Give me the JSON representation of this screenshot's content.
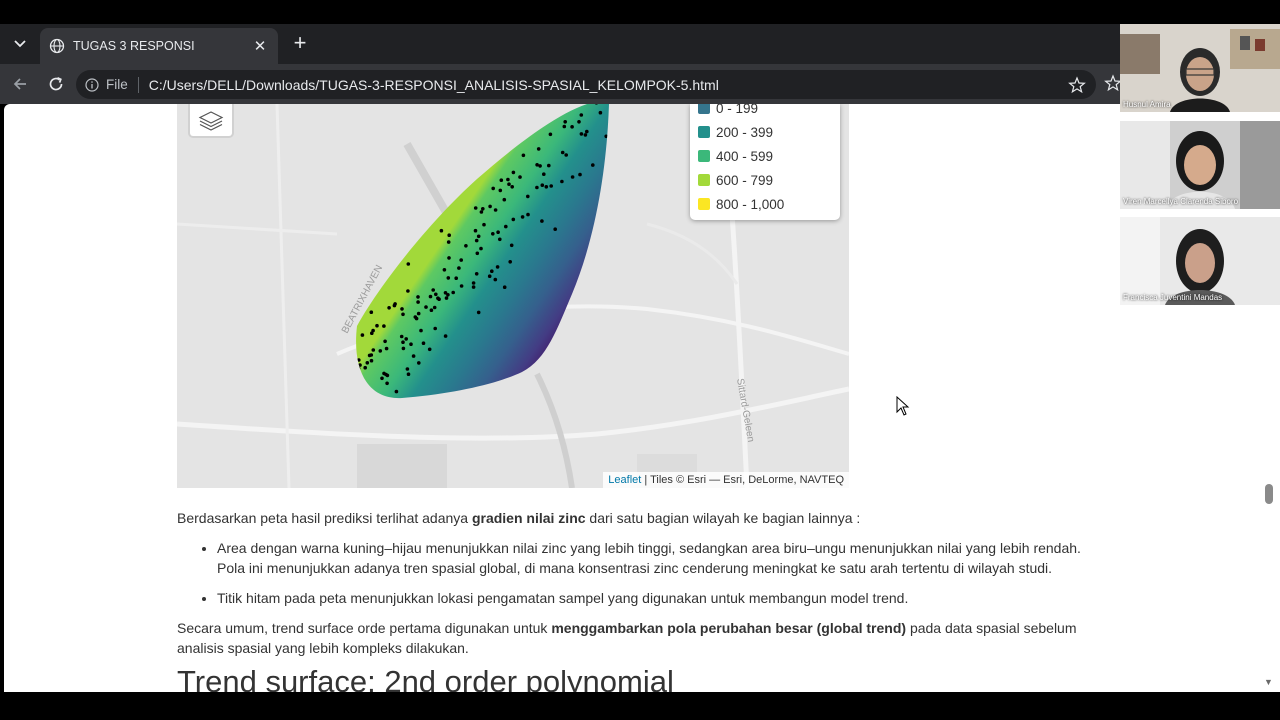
{
  "browser": {
    "tab_title": "TUGAS 3 RESPONSI",
    "url_scheme": "File",
    "url": "C:/Users/DELL/Downloads/TUGAS-3-RESPONSI_ANALISIS-SPASIAL_KELOMPOK-5.html"
  },
  "map": {
    "legend": [
      {
        "label": "0 - 199",
        "color": "#35758d"
      },
      {
        "label": "200 - 399",
        "color": "#23908c"
      },
      {
        "label": "400 - 599",
        "color": "#3bb87a"
      },
      {
        "label": "600 - 799",
        "color": "#a2d93a"
      },
      {
        "label": "800 - 1,000",
        "color": "#fbe623"
      }
    ],
    "street_label_1": "BEATRIXHAVEN",
    "street_label_2": "Sittard-Geleen",
    "attribution_link": "Leaflet",
    "attribution_text": " | Tiles © Esri — Esri, DeLorme, NAVTEQ"
  },
  "content": {
    "p1_a": "Berdasarkan peta hasil prediksi terlihat adanya ",
    "p1_b": "gradien nilai zinc",
    "p1_c": " dari satu bagian wilayah ke bagian lainnya :",
    "bullet1": "Area dengan warna kuning–hijau menunjukkan nilai zinc yang lebih tinggi, sedangkan area biru–ungu menunjukkan nilai yang lebih rendah. Pola ini menunjukkan adanya tren spasial global, di mana konsentrasi zinc cenderung meningkat ke satu arah tertentu di wilayah studi.",
    "bullet2": "Titik hitam pada peta menunjukkan lokasi pengamatan sampel yang digunakan untuk membangun model trend.",
    "p2_a": "Secara umum, trend surface orde pertama digunakan untuk ",
    "p2_b": "menggambarkan pola perubahan besar (global trend)",
    "p2_c": " pada data spasial sebelum analisis spasial yang lebih kompleks dilakukan.",
    "heading": "Trend surface: 2nd order polynomial"
  },
  "participants": [
    {
      "name": "Husnul Amira"
    },
    {
      "name": "Viren Marcellya Clarenda Siboro"
    },
    {
      "name": "Francisca Juventini Mandas"
    }
  ]
}
